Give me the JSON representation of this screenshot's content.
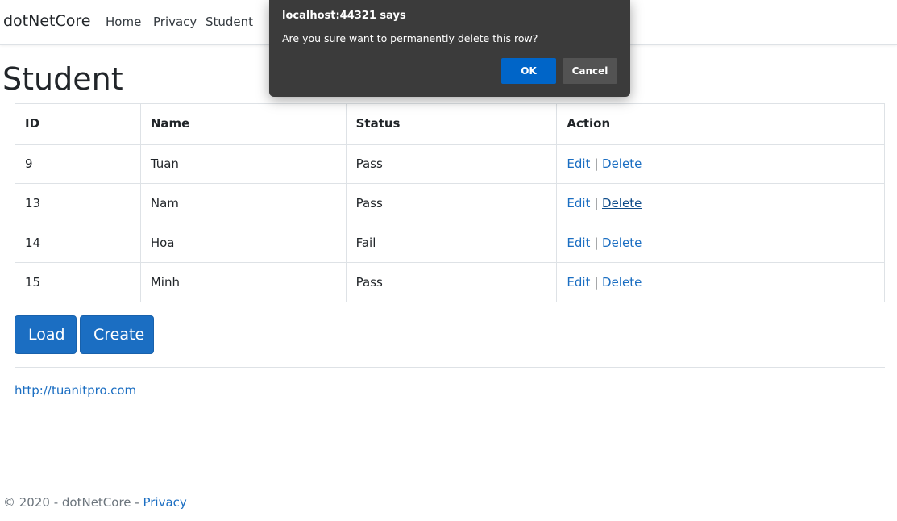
{
  "navbar": {
    "brand": "dotNetCore",
    "links": [
      "Home",
      "Privacy",
      "Student"
    ]
  },
  "page": {
    "title": "Student"
  },
  "table": {
    "headers": [
      "ID",
      "Name",
      "Status",
      "Action"
    ],
    "rows": [
      {
        "id": "9",
        "name": "Tuan",
        "status": "Pass",
        "edit": "Edit",
        "sep": "|",
        "delete": "Delete"
      },
      {
        "id": "13",
        "name": "Nam",
        "status": "Pass",
        "edit": "Edit",
        "sep": "|",
        "delete": "Delete"
      },
      {
        "id": "14",
        "name": "Hoa",
        "status": "Fail",
        "edit": "Edit",
        "sep": "|",
        "delete": "Delete"
      },
      {
        "id": "15",
        "name": "Minh",
        "status": "Pass",
        "edit": "Edit",
        "sep": "|",
        "delete": "Delete"
      }
    ]
  },
  "buttons": {
    "load": "Load",
    "create": "Create"
  },
  "site_link": "http://tuanitpro.com",
  "footer": {
    "text": "© 2020 - dotNetCore - ",
    "privacy": "Privacy"
  },
  "dialog": {
    "title": "localhost:44321 says",
    "message": "Are you sure want to permanently delete this row?",
    "ok": "OK",
    "cancel": "Cancel"
  },
  "colors": {
    "link": "#1b6ec2",
    "primary_button": "#1b6ec2",
    "dialog_background": "#3b3b3b",
    "dialog_ok": "#0065c8",
    "dialog_cancel": "#535353"
  }
}
